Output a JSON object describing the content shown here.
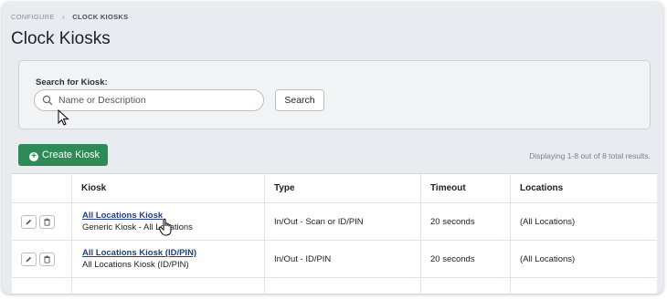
{
  "breadcrumb": {
    "parent": "CONFIGURE",
    "separator": "›",
    "current": "CLOCK KIOSKS"
  },
  "page": {
    "title": "Clock Kiosks"
  },
  "search": {
    "label": "Search for Kiosk:",
    "placeholder": "Name or Description",
    "value": "",
    "button_label": "Search"
  },
  "toolbar": {
    "create_label": "Create Kiosk",
    "results_text": "Displaying 1-8 out of 8 total results."
  },
  "colors": {
    "create_button": "#2e8b57",
    "link": "#1f3f8a"
  },
  "table": {
    "columns": [
      "",
      "Kiosk",
      "Type",
      "Timeout",
      "Locations"
    ],
    "rows": [
      {
        "name": "All Locations Kiosk",
        "description": "Generic Kiosk - All Locations",
        "type": "In/Out - Scan or ID/PIN",
        "timeout": "20 seconds",
        "locations": "(All Locations)"
      },
      {
        "name": "All Locations Kiosk (ID/PIN)",
        "description": "All Locations Kiosk (ID/PIN)",
        "type": "In/Out - ID/PIN",
        "timeout": "20 seconds",
        "locations": "(All Locations)"
      }
    ]
  },
  "icons": {
    "edit": "pencil-icon",
    "delete": "trash-icon",
    "search": "search-icon",
    "create": "plus-circle-icon"
  }
}
